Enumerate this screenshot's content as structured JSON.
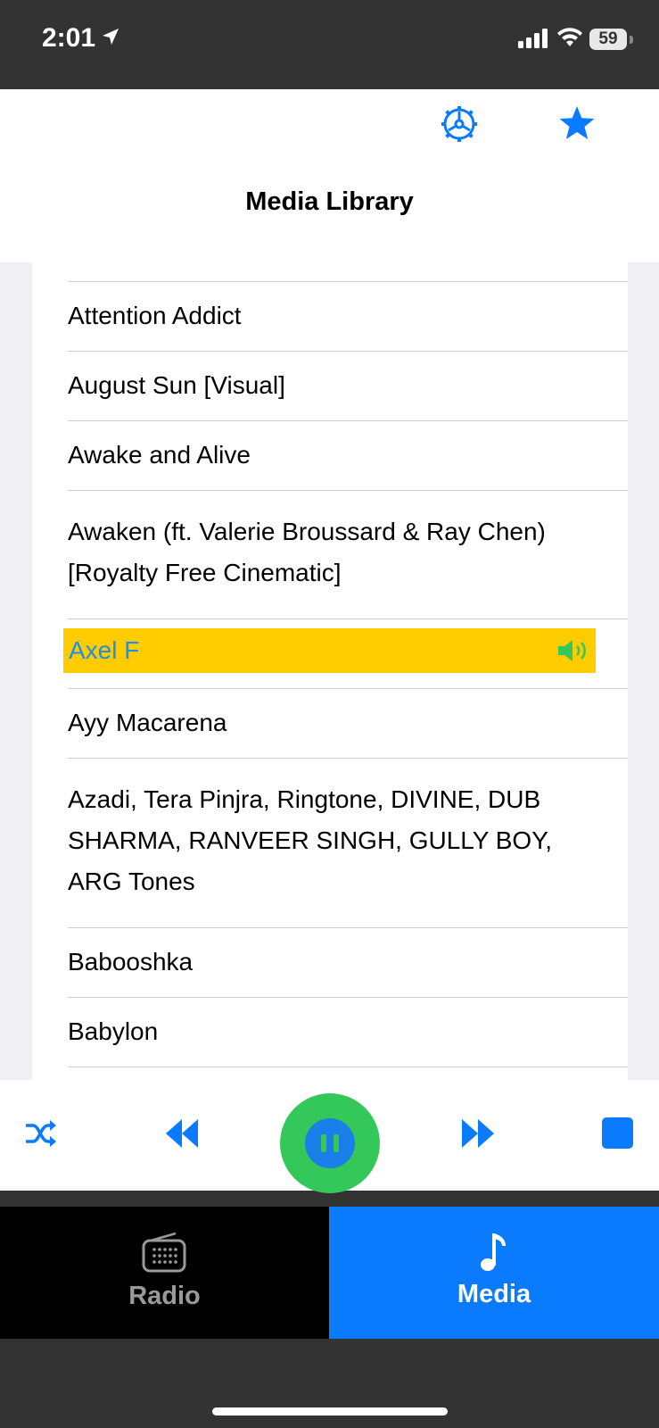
{
  "status_bar": {
    "time": "2:01",
    "battery": "59"
  },
  "header": {
    "title": "Media Library"
  },
  "songs": [
    "Attention Addict",
    "August Sun [Visual]",
    "Awake and Alive",
    "Awaken (ft. Valerie Broussard & Ray Chen)",
    "[Royalty Free Cinematic]",
    "Axel F",
    "Ayy Macarena",
    "Azadi, Tera Pinjra, Ringtone, DIVINE, DUB",
    "SHARMA, RANVEER SINGH, GULLY BOY,",
    "ARG Tones",
    "Babooshka",
    "Babylon"
  ],
  "now_playing_index": 5,
  "tabs": {
    "radio": "Radio",
    "media": "Media",
    "selected": "Media"
  },
  "colors": {
    "accent": "#0a7bff",
    "highlight": "#ffcc00",
    "play": "#34c759",
    "now_playing_text": "#1e90e8"
  },
  "icons": [
    "location-arrow-icon",
    "signal-icon",
    "wifi-icon",
    "battery-icon",
    "gear-icon",
    "star-icon",
    "speaker-icon",
    "shuffle-icon",
    "rewind-icon",
    "pause-icon",
    "fast-forward-icon",
    "stop-icon",
    "radio-icon",
    "music-note-icon"
  ]
}
